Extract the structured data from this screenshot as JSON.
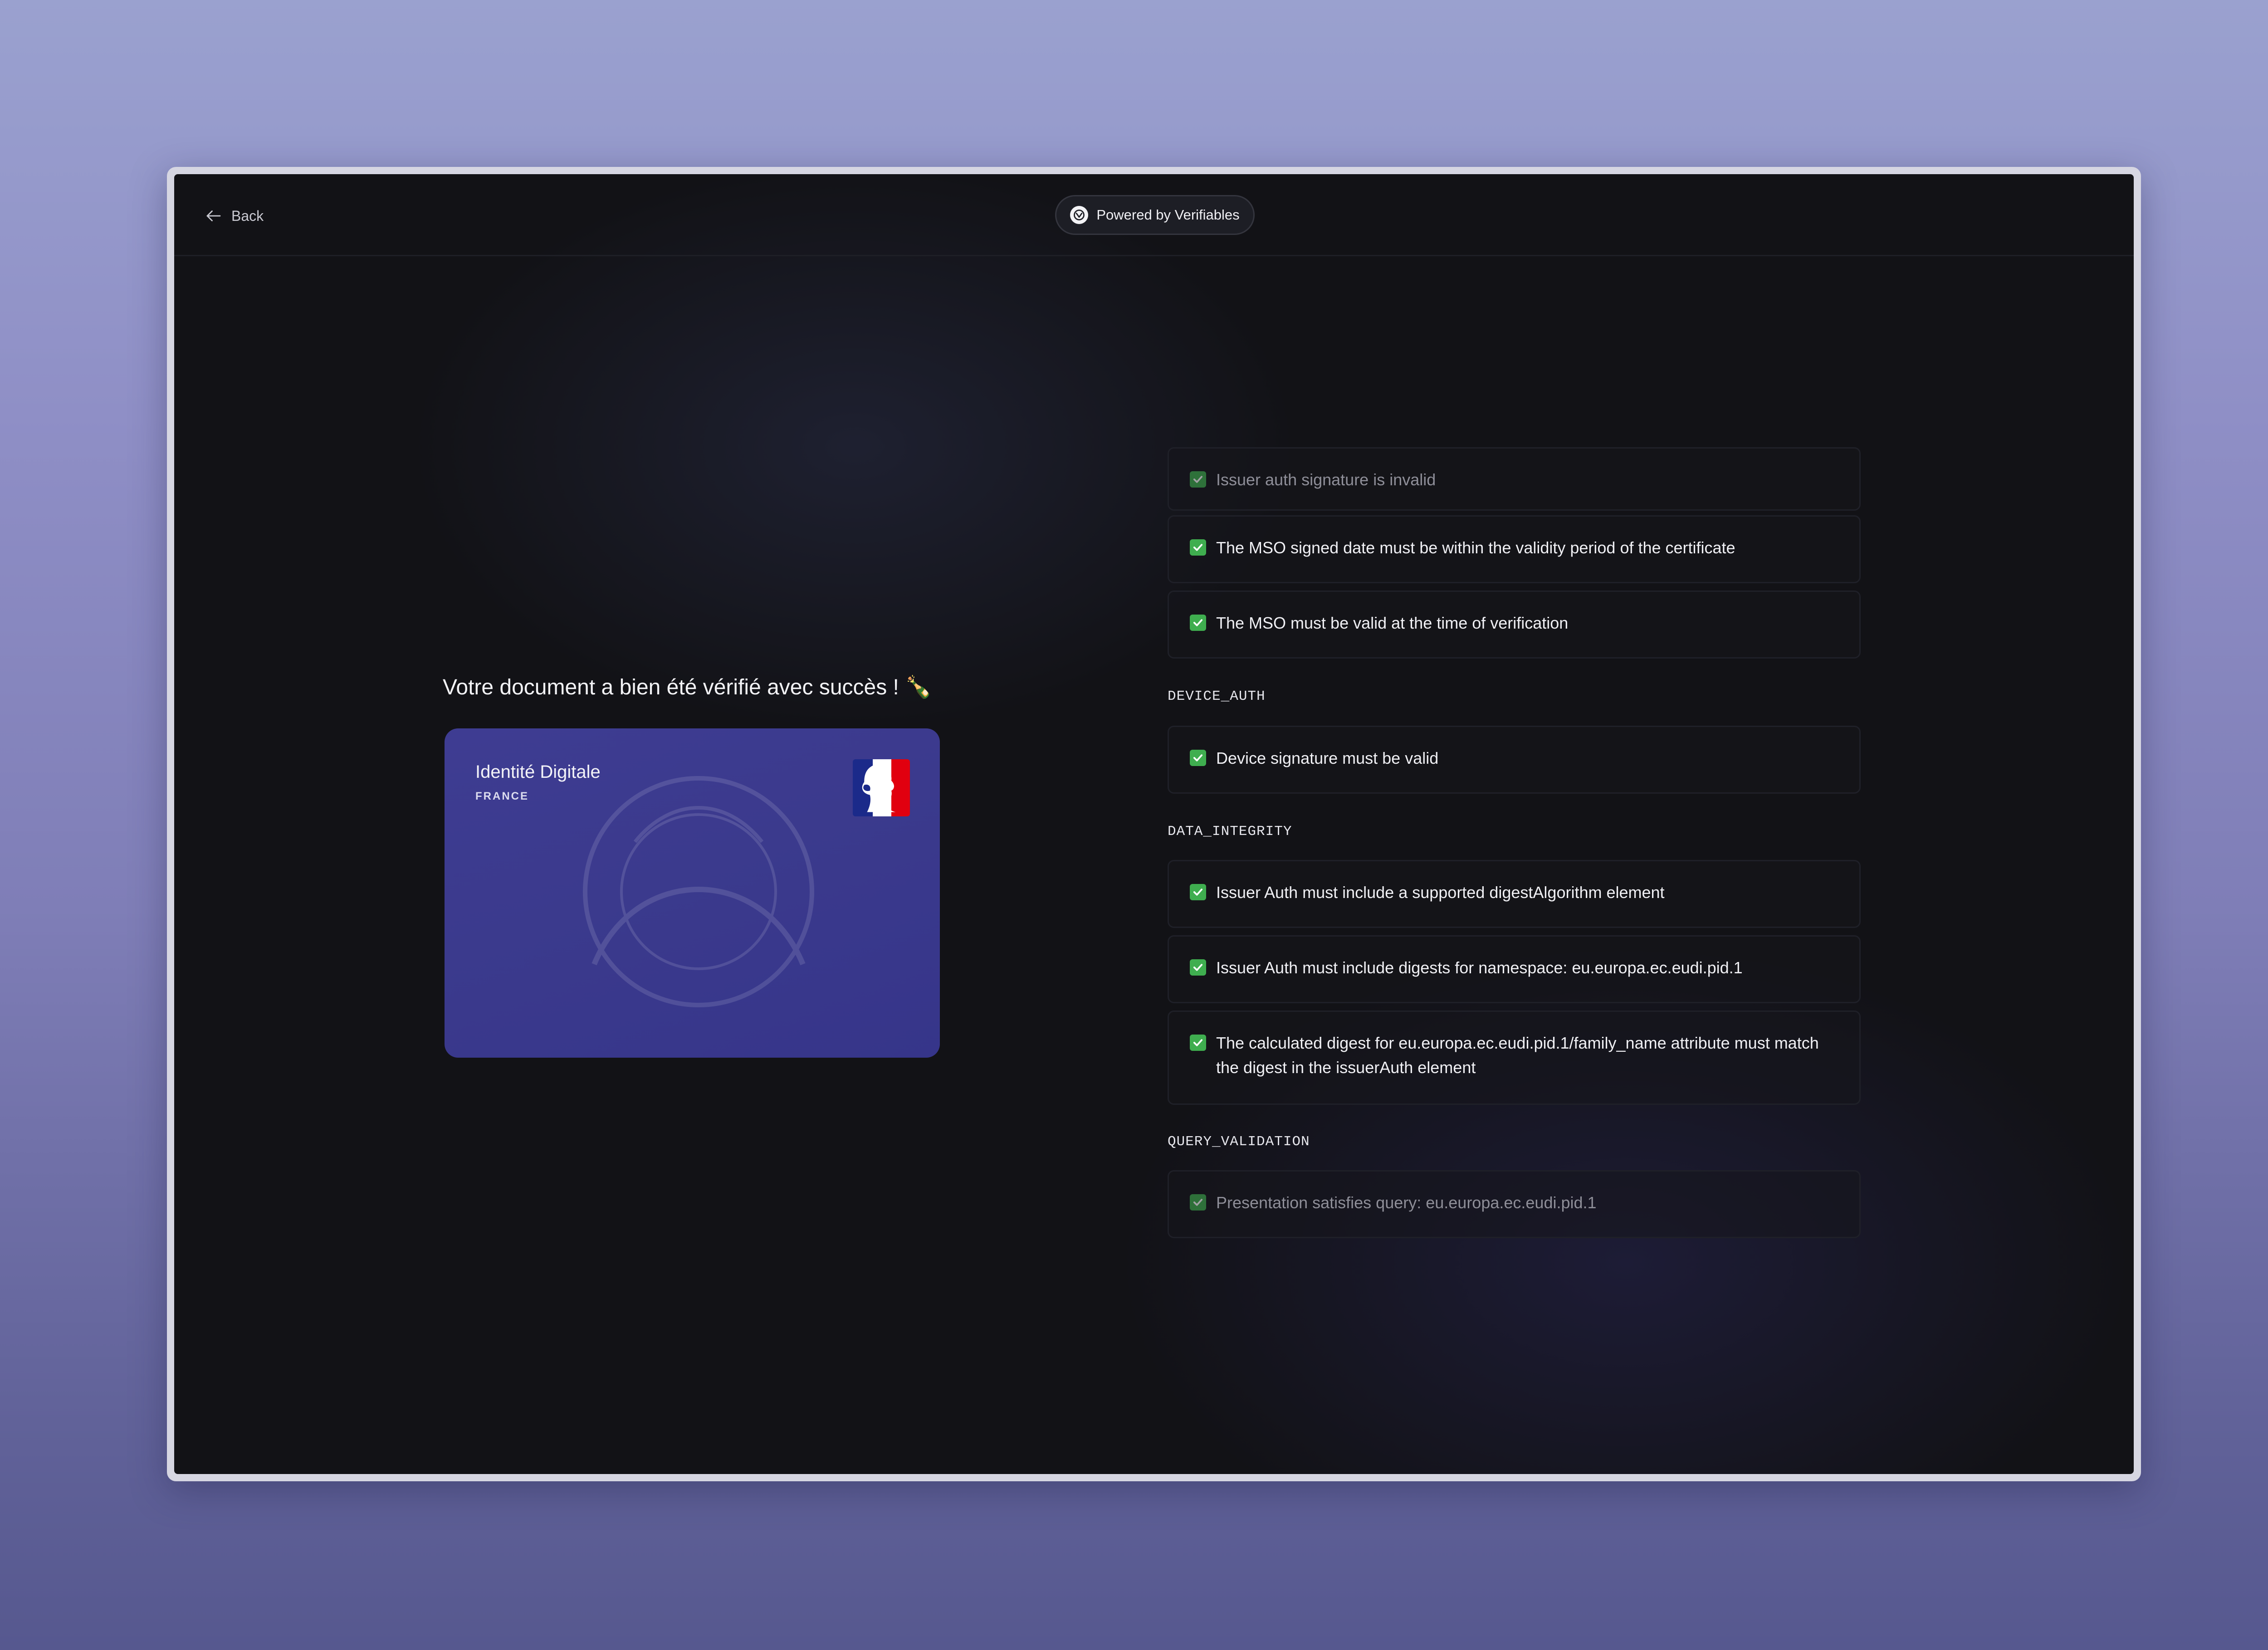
{
  "header": {
    "back_label": "Back",
    "powered_label": "Powered by Verifiables"
  },
  "main": {
    "headline": "Votre document a bien été vérifié avec succès ! 🍾"
  },
  "card": {
    "title": "Identité Digitale",
    "subtitle": "FRANCE",
    "background_color": "#3b3a8d"
  },
  "checks": {
    "issuer_signature": "Issuer auth signature is invalid",
    "mso_signed_date": "The MSO signed date must be within the validity period of the certificate",
    "mso_valid": "The MSO must be valid at the time of verification",
    "device_auth_label": "DEVICE_AUTH",
    "device_signature": "Device signature must be valid",
    "data_integrity_label": "DATA_INTEGRITY",
    "digest_algorithm": "Issuer Auth must include a supported digestAlgorithm element",
    "digests_namespace": "Issuer Auth must include digests for namespace: eu.europa.ec.eudi.pid.1",
    "calculated_digest": "The calculated digest for eu.europa.ec.eudi.pid.1/family_name attribute must match the digest in the issuerAuth element",
    "query_validation_label": "QUERY_VALIDATION",
    "presentation_query": "Presentation satisfies query: eu.europa.ec.eudi.pid.1"
  },
  "colors": {
    "check_green": "#3fae4f",
    "background_dark": "#121216",
    "page_gradient_top": "#9aa1cf",
    "page_gradient_bottom": "#56588f"
  }
}
